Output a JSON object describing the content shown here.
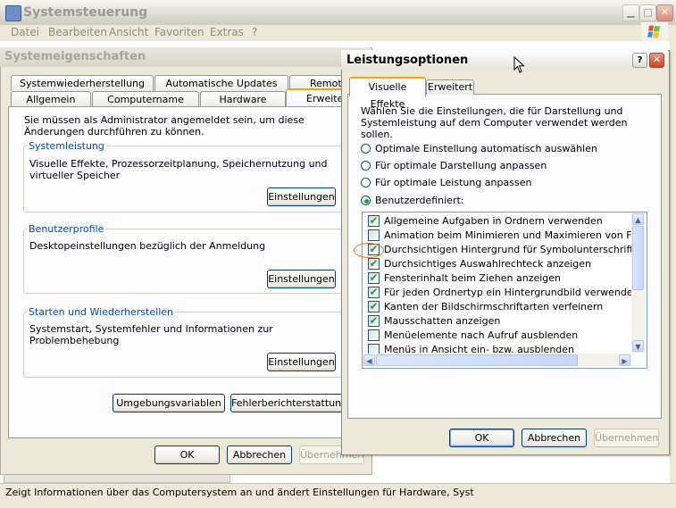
{
  "control_panel": {
    "title": "Systemsteuerung",
    "menu": [
      "Datei",
      "Bearbeiten",
      "Ansicht",
      "Favoriten",
      "Extras",
      "?"
    ],
    "status_text": "Zeigt Informationen über das Computersystem an und ändert Einstellungen für Hardware, Syst"
  },
  "system_properties": {
    "title": "Systemeigenschaften",
    "tabs_row1": [
      "Systemwiederherstellung",
      "Automatische Updates",
      "Remote"
    ],
    "tabs_row2": [
      "Allgemein",
      "Computername",
      "Hardware",
      "Erweitert"
    ],
    "admin_note": "Sie müssen als Administrator angemeldet sein, um diese Änderungen durchführen zu können.",
    "groups": [
      {
        "title": "Systemleistung",
        "text": "Visuelle Effekte, Prozessorzeitplanung, Speichernutzung und virtueller Speicher",
        "button": "Einstellungen"
      },
      {
        "title": "Benutzerprofile",
        "text": "Desktopeinstellungen bezüglich der Anmeldung",
        "button": "Einstellungen"
      },
      {
        "title": "Starten und Wiederherstellen",
        "text": "Systemstart, Systemfehler und Informationen zur Problembehebung",
        "button": "Einstellungen"
      }
    ],
    "env_button": "Umgebungsvariablen",
    "error_button": "Fehlerberichterstattung",
    "ok": "OK",
    "cancel": "Abbrechen",
    "apply": "Übernehmen"
  },
  "performance_options": {
    "title": "Leistungsoptionen",
    "help_glyph": "?",
    "close_glyph": "✕",
    "tabs": [
      "Visuelle Effekte",
      "Erweitert"
    ],
    "description": "Wählen Sie die Einstellungen, die für Darstellung und Systemleistung auf dem Computer verwendet werden sollen.",
    "radios": [
      {
        "label": "Optimale Einstellung automatisch auswählen",
        "selected": false
      },
      {
        "label": "Für optimale Darstellung anpassen",
        "selected": false
      },
      {
        "label": "Für optimale Leistung anpassen",
        "selected": false
      },
      {
        "label": "Benutzerdefiniert:",
        "selected": true
      }
    ],
    "effects": [
      {
        "label": "Allgemeine Aufgaben in Ordnern verwenden",
        "checked": true
      },
      {
        "label": "Animation beim Minimieren und Maximieren von Fenstern",
        "checked": false
      },
      {
        "label": "Durchsichtigen Hintergrund für Symbolunterschriften auf d",
        "checked": true
      },
      {
        "label": "Durchsichtiges Auswahlrechteck anzeigen",
        "checked": true
      },
      {
        "label": "Fensterinhalt beim Ziehen anzeigen",
        "checked": true
      },
      {
        "label": "Für jeden Ordnertyp ein Hintergrundbild verwenden",
        "checked": true
      },
      {
        "label": "Kanten der Bildschirmschriftarten verfeinern",
        "checked": true
      },
      {
        "label": "Mausschatten anzeigen",
        "checked": true
      },
      {
        "label": "Menüelemente nach Aufruf ausblenden",
        "checked": false
      },
      {
        "label": "Menüs in Ansicht ein- bzw. ausblenden",
        "checked": false
      }
    ],
    "ok": "OK",
    "cancel": "Abbrechen",
    "apply": "Übernehmen"
  },
  "icons": {
    "check": "✔",
    "scroll_up": "▲",
    "scroll_down": "▼",
    "scroll_left": "◀",
    "scroll_right": "▶",
    "minimize": "▁",
    "maximize": "□",
    "close": "✕"
  }
}
